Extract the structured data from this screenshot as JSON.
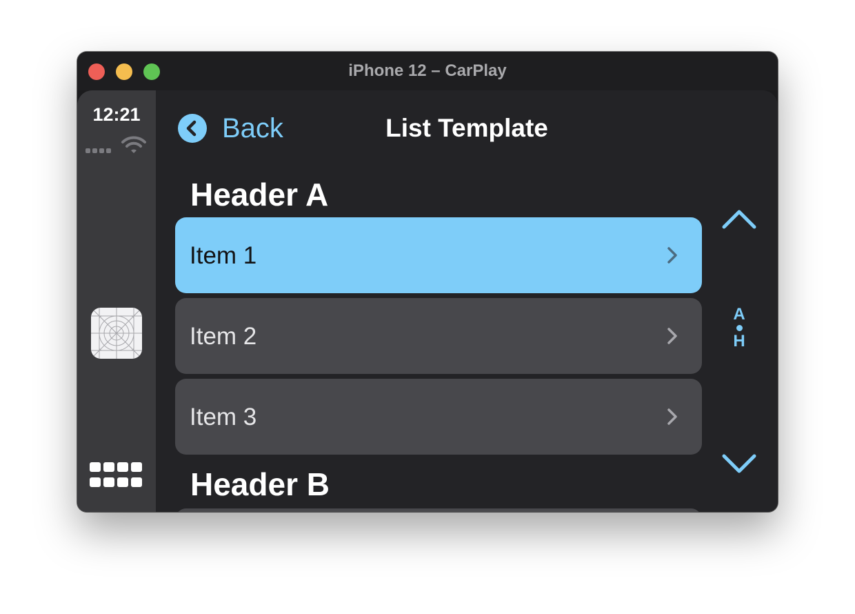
{
  "window": {
    "title": "iPhone 12 – CarPlay"
  },
  "statusbar": {
    "time": "12:21",
    "icons": [
      "cellular-signal-icon",
      "wifi-icon",
      "app-icon",
      "app-grid-icon"
    ]
  },
  "nav": {
    "back_label": "Back",
    "title": "List Template"
  },
  "sections": [
    {
      "header": "Header A",
      "items": [
        {
          "label": "Item 1",
          "selected": true
        },
        {
          "label": "Item 2",
          "selected": false
        },
        {
          "label": "Item 3",
          "selected": false
        }
      ]
    },
    {
      "header": "Header B",
      "items": []
    }
  ],
  "index_bar": {
    "top": "A",
    "bottom": "H"
  },
  "colors": {
    "accent": "#7ecdf9",
    "background": "#232326",
    "row": "#48484c",
    "sidebar": "#3a3a3d",
    "titlebar": "#1e1e20"
  }
}
